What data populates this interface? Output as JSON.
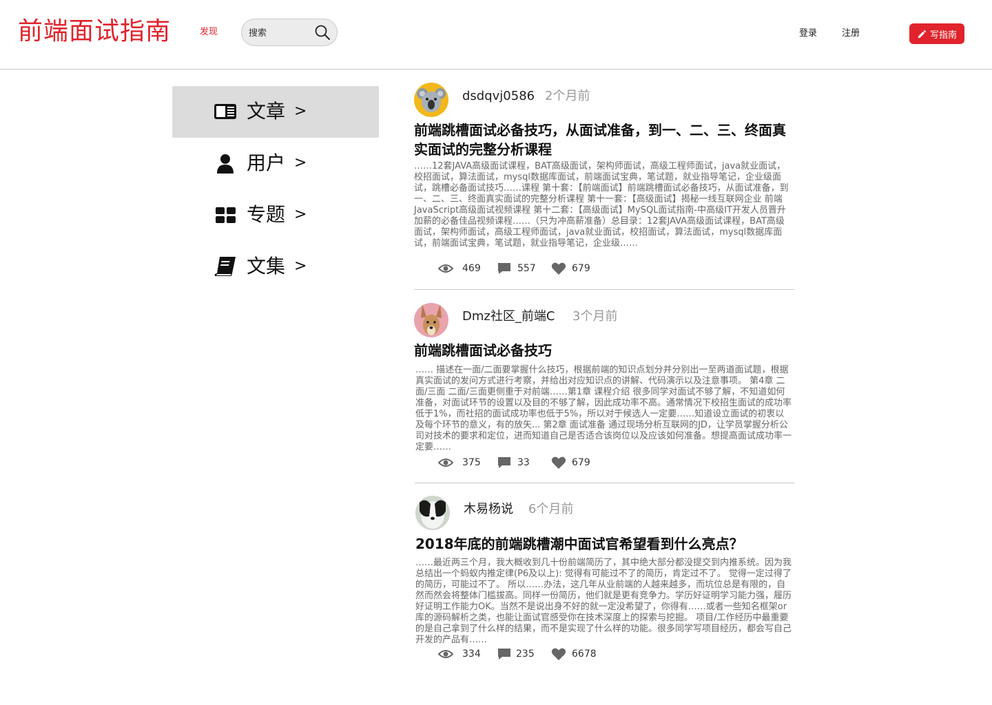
{
  "header": {
    "logo": "前端面试指南",
    "discover_label": "发现",
    "search_placeholder": "搜索",
    "login_label": "登录",
    "register_label": "注册",
    "write_label": "写指南",
    "accent_color": "#e0232c"
  },
  "sidebar": {
    "items": [
      {
        "label": "文章",
        "arrow": ">",
        "icon": "newspaper-icon",
        "active": true
      },
      {
        "label": "用户",
        "arrow": ">",
        "icon": "user-icon",
        "active": false
      },
      {
        "label": "专题",
        "arrow": ">",
        "icon": "grid-icon",
        "active": false
      },
      {
        "label": "文集",
        "arrow": ">",
        "icon": "book-icon",
        "active": false
      }
    ]
  },
  "feed": {
    "articles": [
      {
        "author": "dsdqvj0586",
        "time": "2个月前",
        "avatar": "koala-avatar",
        "title": "前端跳槽面试必备技巧，从面试准备，到一、二、三、终面真实面试的完整分析课程",
        "excerpt": "……12套JAVA高级面试课程，BAT高级面试，架构师面试，高级工程师面试，java就业面试，校招面试，算法面试，mysql数据库面试，前端面试宝典，笔试题，就业指导笔记，企业级面试，跳槽必备面试技巧……课程 第十套：【前端面试】前端跳槽面试必备技巧，从面试准备，到一、二、三、终面真实面试的完整分析课程 第十一套：【高级面试】揭秘一线互联网企业 前端JavaScript高级面试视频课程 第十二套：【高级面试】MySQL面试指南-中高级IT开发人员晋升加薪的必备佳品视频课程……（只为冲高薪准备）总目录：12套JAVA高级面试课程，BAT高级面试，架构师面试，高级工程师面试，java就业面试，校招面试，算法面试，mysql数据库面试，前端面试宝典，笔试题，就业指导笔记，企业级……",
        "views": "469",
        "comments": "557",
        "likes": "679"
      },
      {
        "author": "Dmz社区_前端C",
        "time": "3个月前",
        "avatar": "dog-avatar",
        "title": "前端跳槽面试必备技巧",
        "excerpt": "…… 描述在一面/二面要掌握什么技巧，根据前端的知识点划分并分别出一至两道面试题，根据真实面试的发问方式进行考察，并给出对应知识点的讲解、代码演示以及注意事项。 第4章 二面/三面 二面/三面更侧重于对前端……第1章 课程介绍 很多同学对面试不够了解，不知道如何准备，对面试环节的设置以及目的不够了解，因此成功率不高。通常情况下校招生面试的成功率低于1%，而社招的面试成功率也低于5%，所以对于候选人一定要……知道设立面试的初衷以及每个环节的意义，有的放矢... 第2章 面试准备 通过现场分析互联网的JD，让学员掌握分析公司对技术的要求和定位，进而知道自己是否适合该岗位以及应该如何准备。想提高面试成功率一定要……",
        "views": "375",
        "comments": "33",
        "likes": "679"
      },
      {
        "author": "木易杨说",
        "time": "6个月前",
        "avatar": "puppy-avatar",
        "title": "2018年底的前端跳槽潮中面试官希望看到什么亮点？",
        "excerpt": "……最近两三个月，我大概收到几十份前端简历了，其中绝大部分都没提交到内推系统。因为我总结出一个蚂蚁内推定律(P6及以上): 觉得有可能过不了的简历，肯定过不了。 觉得一定过得了的简历，可能过不了。 所以……办法，这几年从业前端的人越来越多，而坑位总是有限的，自然而然会将整体门槛拔高。同样一份简历，他们就是更有竞争力。学历好证明学习能力强，履历好证明工作能力OK。当然不是说出身不好的就一定没希望了，你得有……或者一些知名框架or库的源码解析之类，也能让面试官感受你在技术深度上的探索与挖掘。 项目/工作经历中最重要的是自己拿到了什么样的结果，而不是实现了什么样的功能。很多同学写项目经历，都会写自己开发的产品有……",
        "views": "334",
        "comments": "235",
        "likes": "6678"
      }
    ]
  }
}
